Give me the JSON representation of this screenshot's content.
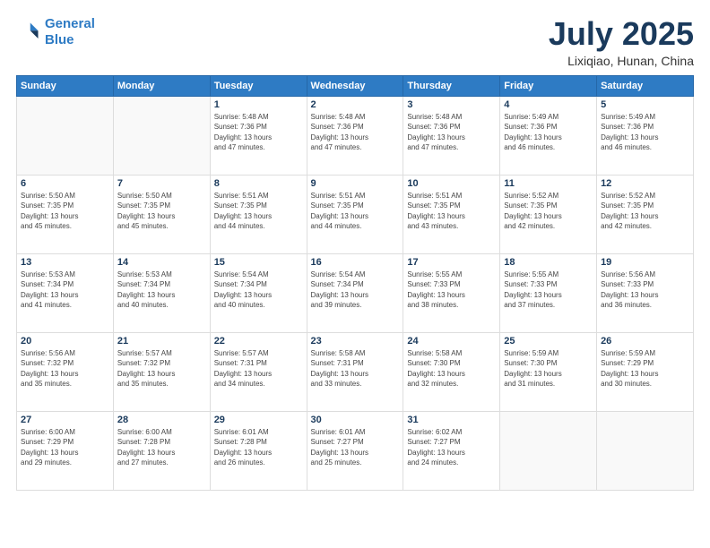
{
  "header": {
    "logo_line1": "General",
    "logo_line2": "Blue",
    "month_title": "July 2025",
    "location": "Lixiqiao, Hunan, China"
  },
  "weekdays": [
    "Sunday",
    "Monday",
    "Tuesday",
    "Wednesday",
    "Thursday",
    "Friday",
    "Saturday"
  ],
  "weeks": [
    [
      {
        "day": "",
        "info": ""
      },
      {
        "day": "",
        "info": ""
      },
      {
        "day": "1",
        "info": "Sunrise: 5:48 AM\nSunset: 7:36 PM\nDaylight: 13 hours\nand 47 minutes."
      },
      {
        "day": "2",
        "info": "Sunrise: 5:48 AM\nSunset: 7:36 PM\nDaylight: 13 hours\nand 47 minutes."
      },
      {
        "day": "3",
        "info": "Sunrise: 5:48 AM\nSunset: 7:36 PM\nDaylight: 13 hours\nand 47 minutes."
      },
      {
        "day": "4",
        "info": "Sunrise: 5:49 AM\nSunset: 7:36 PM\nDaylight: 13 hours\nand 46 minutes."
      },
      {
        "day": "5",
        "info": "Sunrise: 5:49 AM\nSunset: 7:36 PM\nDaylight: 13 hours\nand 46 minutes."
      }
    ],
    [
      {
        "day": "6",
        "info": "Sunrise: 5:50 AM\nSunset: 7:35 PM\nDaylight: 13 hours\nand 45 minutes."
      },
      {
        "day": "7",
        "info": "Sunrise: 5:50 AM\nSunset: 7:35 PM\nDaylight: 13 hours\nand 45 minutes."
      },
      {
        "day": "8",
        "info": "Sunrise: 5:51 AM\nSunset: 7:35 PM\nDaylight: 13 hours\nand 44 minutes."
      },
      {
        "day": "9",
        "info": "Sunrise: 5:51 AM\nSunset: 7:35 PM\nDaylight: 13 hours\nand 44 minutes."
      },
      {
        "day": "10",
        "info": "Sunrise: 5:51 AM\nSunset: 7:35 PM\nDaylight: 13 hours\nand 43 minutes."
      },
      {
        "day": "11",
        "info": "Sunrise: 5:52 AM\nSunset: 7:35 PM\nDaylight: 13 hours\nand 42 minutes."
      },
      {
        "day": "12",
        "info": "Sunrise: 5:52 AM\nSunset: 7:35 PM\nDaylight: 13 hours\nand 42 minutes."
      }
    ],
    [
      {
        "day": "13",
        "info": "Sunrise: 5:53 AM\nSunset: 7:34 PM\nDaylight: 13 hours\nand 41 minutes."
      },
      {
        "day": "14",
        "info": "Sunrise: 5:53 AM\nSunset: 7:34 PM\nDaylight: 13 hours\nand 40 minutes."
      },
      {
        "day": "15",
        "info": "Sunrise: 5:54 AM\nSunset: 7:34 PM\nDaylight: 13 hours\nand 40 minutes."
      },
      {
        "day": "16",
        "info": "Sunrise: 5:54 AM\nSunset: 7:34 PM\nDaylight: 13 hours\nand 39 minutes."
      },
      {
        "day": "17",
        "info": "Sunrise: 5:55 AM\nSunset: 7:33 PM\nDaylight: 13 hours\nand 38 minutes."
      },
      {
        "day": "18",
        "info": "Sunrise: 5:55 AM\nSunset: 7:33 PM\nDaylight: 13 hours\nand 37 minutes."
      },
      {
        "day": "19",
        "info": "Sunrise: 5:56 AM\nSunset: 7:33 PM\nDaylight: 13 hours\nand 36 minutes."
      }
    ],
    [
      {
        "day": "20",
        "info": "Sunrise: 5:56 AM\nSunset: 7:32 PM\nDaylight: 13 hours\nand 35 minutes."
      },
      {
        "day": "21",
        "info": "Sunrise: 5:57 AM\nSunset: 7:32 PM\nDaylight: 13 hours\nand 35 minutes."
      },
      {
        "day": "22",
        "info": "Sunrise: 5:57 AM\nSunset: 7:31 PM\nDaylight: 13 hours\nand 34 minutes."
      },
      {
        "day": "23",
        "info": "Sunrise: 5:58 AM\nSunset: 7:31 PM\nDaylight: 13 hours\nand 33 minutes."
      },
      {
        "day": "24",
        "info": "Sunrise: 5:58 AM\nSunset: 7:30 PM\nDaylight: 13 hours\nand 32 minutes."
      },
      {
        "day": "25",
        "info": "Sunrise: 5:59 AM\nSunset: 7:30 PM\nDaylight: 13 hours\nand 31 minutes."
      },
      {
        "day": "26",
        "info": "Sunrise: 5:59 AM\nSunset: 7:29 PM\nDaylight: 13 hours\nand 30 minutes."
      }
    ],
    [
      {
        "day": "27",
        "info": "Sunrise: 6:00 AM\nSunset: 7:29 PM\nDaylight: 13 hours\nand 29 minutes."
      },
      {
        "day": "28",
        "info": "Sunrise: 6:00 AM\nSunset: 7:28 PM\nDaylight: 13 hours\nand 27 minutes."
      },
      {
        "day": "29",
        "info": "Sunrise: 6:01 AM\nSunset: 7:28 PM\nDaylight: 13 hours\nand 26 minutes."
      },
      {
        "day": "30",
        "info": "Sunrise: 6:01 AM\nSunset: 7:27 PM\nDaylight: 13 hours\nand 25 minutes."
      },
      {
        "day": "31",
        "info": "Sunrise: 6:02 AM\nSunset: 7:27 PM\nDaylight: 13 hours\nand 24 minutes."
      },
      {
        "day": "",
        "info": ""
      },
      {
        "day": "",
        "info": ""
      }
    ]
  ]
}
